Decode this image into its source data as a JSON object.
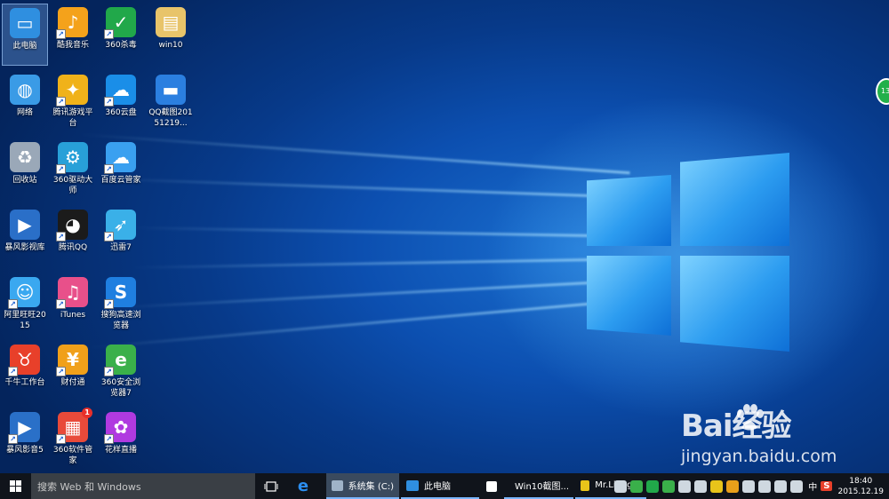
{
  "desktop": {
    "icons": [
      {
        "label": "此电脑",
        "icon": "computer-icon",
        "color": "#2f8fe0",
        "col": 0,
        "row": 0,
        "selected": true,
        "shortcut": false
      },
      {
        "label": "酷我音乐",
        "icon": "music-icon",
        "color": "#f4a21b",
        "col": 1,
        "row": 0,
        "shortcut": true
      },
      {
        "label": "360杀毒",
        "icon": "shield-icon",
        "color": "#21a84a",
        "col": 2,
        "row": 0,
        "shortcut": true
      },
      {
        "label": "win10",
        "icon": "folder-icon",
        "color": "#e8c46a",
        "col": 3,
        "row": 0,
        "shortcut": false
      },
      {
        "label": "网络",
        "icon": "network-icon",
        "color": "#3a9be6",
        "col": 0,
        "row": 1,
        "shortcut": false
      },
      {
        "label": "腾讯游戏平台",
        "icon": "game-platform-icon",
        "color": "#f0b21a",
        "col": 1,
        "row": 1,
        "shortcut": true
      },
      {
        "label": "360云盘",
        "icon": "cloud-icon",
        "color": "#1a8ee8",
        "col": 2,
        "row": 1,
        "shortcut": true
      },
      {
        "label": "QQ截图20151219...",
        "icon": "image-file-icon",
        "color": "#2b7fe0",
        "col": 3,
        "row": 1,
        "shortcut": false
      },
      {
        "label": "回收站",
        "icon": "recycle-bin-icon",
        "color": "#9aa8b8",
        "col": 0,
        "row": 2,
        "shortcut": false
      },
      {
        "label": "360驱动大师",
        "icon": "driver-icon",
        "color": "#28a0d8",
        "col": 1,
        "row": 2,
        "shortcut": true
      },
      {
        "label": "百度云管家",
        "icon": "baidu-cloud-icon",
        "color": "#3aa0f0",
        "col": 2,
        "row": 2,
        "shortcut": true
      },
      {
        "label": "暴风影视库",
        "icon": "video-library-icon",
        "color": "#2a6fc8",
        "col": 0,
        "row": 3,
        "shortcut": false
      },
      {
        "label": "腾讯QQ",
        "icon": "qq-icon",
        "color": "#1b1b1b",
        "col": 1,
        "row": 3,
        "shortcut": true
      },
      {
        "label": "迅雷7",
        "icon": "thunder-icon",
        "color": "#3ab0e8",
        "col": 2,
        "row": 3,
        "shortcut": true
      },
      {
        "label": "阿里旺旺2015",
        "icon": "aliwangwang-icon",
        "color": "#3aa8f0",
        "col": 0,
        "row": 4,
        "shortcut": true
      },
      {
        "label": "iTunes",
        "icon": "itunes-icon",
        "color": "#e8508a",
        "col": 1,
        "row": 4,
        "shortcut": true
      },
      {
        "label": "搜狗高速浏览器",
        "icon": "sogou-browser-icon",
        "color": "#1f7fe0",
        "col": 2,
        "row": 4,
        "shortcut": true
      },
      {
        "label": "千牛工作台",
        "icon": "qianniu-icon",
        "color": "#e8402a",
        "col": 0,
        "row": 5,
        "shortcut": true
      },
      {
        "label": "财付通",
        "icon": "tenpay-icon",
        "color": "#f0a01a",
        "col": 1,
        "row": 5,
        "shortcut": true
      },
      {
        "label": "360安全浏览器7",
        "icon": "360-browser-icon",
        "color": "#3ab04a",
        "col": 2,
        "row": 5,
        "shortcut": true
      },
      {
        "label": "暴风影音5",
        "icon": "baofeng-player-icon",
        "color": "#2a70c8",
        "col": 0,
        "row": 6,
        "shortcut": true
      },
      {
        "label": "360软件管家",
        "icon": "software-manager-icon",
        "color": "#e84a3a",
        "col": 1,
        "row": 6,
        "shortcut": true,
        "badge": "1"
      },
      {
        "label": "花样直播",
        "icon": "live-stream-icon",
        "color": "#b03ae0",
        "col": 2,
        "row": 6,
        "shortcut": true
      }
    ],
    "side_widget": "13",
    "watermark": {
      "brand": "Bai经验",
      "url": "jingyan.baidu.com"
    }
  },
  "taskbar": {
    "search_placeholder": "搜索 Web 和 Windows",
    "tasks": [
      {
        "label": "系统集 (C:)",
        "icon": "drive-icon",
        "color": "#9fb3c8",
        "active": true
      },
      {
        "label": "此电脑",
        "icon": "computer-icon",
        "color": "#2f8fe0",
        "active": false
      },
      {
        "label": "",
        "icon": "store-icon",
        "color": "#ffffff",
        "active": false
      },
      {
        "label": "Win10截图...",
        "icon": "360-browser-icon",
        "color": "#3ab04a",
        "active": false
      },
      {
        "label": "Mr.Liang...",
        "icon": "qq-icon",
        "color": "#e8c41a",
        "active": false
      }
    ],
    "tray_icons": [
      "cloud-icon",
      "shield-icon",
      "green-shield-icon",
      "wechat-icon",
      "phone-icon",
      "monitor-icon",
      "cat-icon",
      "bag-icon",
      "battery-icon",
      "network-icon",
      "speaker-icon",
      "message-icon"
    ],
    "ime": "中",
    "sogou": "S",
    "clock_time": "18:40",
    "clock_date": "2015.12.19"
  }
}
